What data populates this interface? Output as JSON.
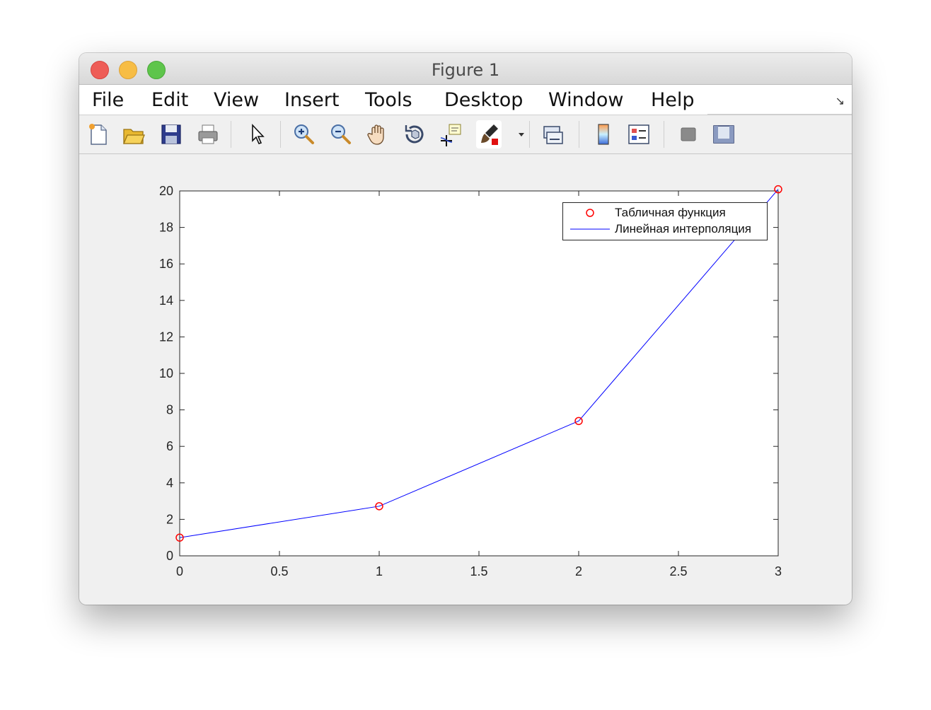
{
  "window": {
    "title": "Figure 1"
  },
  "menu": {
    "items": [
      "File",
      "Edit",
      "View",
      "Insert",
      "Tools",
      "Desktop",
      "Window",
      "Help"
    ]
  },
  "toolbar": {
    "buttons": [
      {
        "icon": "new-figure-icon"
      },
      {
        "icon": "open-file-icon"
      },
      {
        "icon": "save-icon"
      },
      {
        "icon": "print-icon"
      },
      {
        "icon": "pointer-icon"
      },
      {
        "icon": "zoom-in-icon"
      },
      {
        "icon": "zoom-out-icon"
      },
      {
        "icon": "pan-icon"
      },
      {
        "icon": "rotate-3d-icon"
      },
      {
        "icon": "data-cursor-icon"
      },
      {
        "icon": "brush-icon"
      },
      {
        "icon": "link-plot-icon"
      },
      {
        "icon": "colorbar-icon"
      },
      {
        "icon": "legend-icon"
      },
      {
        "icon": "hide-plot-tools-icon"
      },
      {
        "icon": "show-plot-tools-icon"
      }
    ]
  },
  "legend": {
    "entries": [
      "Табличная функция",
      "Линейная интерполяция"
    ]
  },
  "chart_data": {
    "type": "line",
    "title": "",
    "xlabel": "",
    "ylabel": "",
    "xlim": [
      0,
      3
    ],
    "ylim": [
      0,
      20
    ],
    "xticks": [
      0,
      0.5,
      1,
      1.5,
      2,
      2.5,
      3
    ],
    "xtick_labels": [
      "0",
      "0.5",
      "1",
      "1.5",
      "2",
      "2.5",
      "3"
    ],
    "yticks": [
      0,
      2,
      4,
      6,
      8,
      10,
      12,
      14,
      16,
      18,
      20
    ],
    "ytick_labels": [
      "0",
      "2",
      "4",
      "6",
      "8",
      "10",
      "12",
      "14",
      "16",
      "18",
      "20"
    ],
    "grid": false,
    "legend_position": "top-right",
    "series": [
      {
        "name": "Табличная функция",
        "style": "markers",
        "marker": "circle",
        "color": "#ff0000",
        "x": [
          0,
          1,
          2,
          3
        ],
        "y": [
          1.0,
          2.72,
          7.39,
          20.09
        ]
      },
      {
        "name": "Линейная интерполяция",
        "style": "line",
        "color": "#0000ff",
        "x": [
          0,
          1,
          2,
          3
        ],
        "y": [
          1.0,
          2.72,
          7.39,
          20.09
        ]
      }
    ]
  }
}
